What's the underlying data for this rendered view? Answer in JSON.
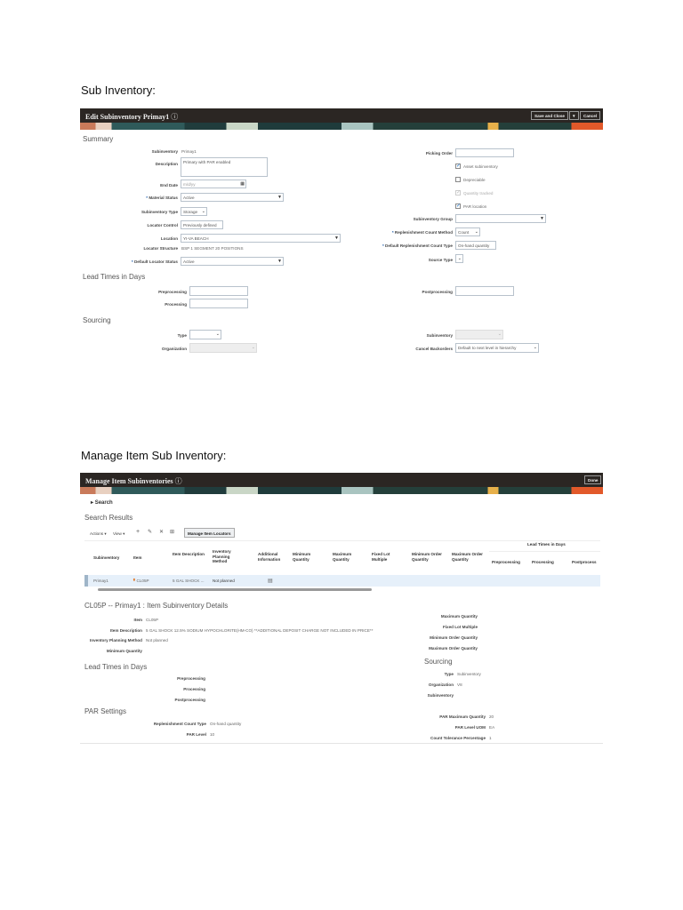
{
  "doc": {
    "heading1": "Sub Inventory:",
    "heading2": "Manage Item Sub Inventory:"
  },
  "edit": {
    "title": "Edit Subinventory Primay1",
    "help_icon": "question-circle-icon",
    "save_close": "Save and Close",
    "save_menu": "▼",
    "cancel": "Cancel",
    "summary": "Summary",
    "subinventory_label": "Subinventory",
    "subinventory": "Primay1",
    "description_label": "Description",
    "description": "Primary with PAR enabled",
    "end_date_label": "End Date",
    "end_date_placeholder": "m/d/yy",
    "material_status_label": "Material Status",
    "material_status": "Active",
    "sub_type_label": "Subinventory Type",
    "sub_type": "Storage",
    "locator_control_label": "Locator Control",
    "locator_control": "Previously defined",
    "location_label": "Location",
    "location": "YI-VA BEACH",
    "locator_structure_label": "Locator Structure",
    "locator_structure": "BSP 1 SEGMENT 20 POSITIONS",
    "default_locator_status_label": "Default Locator Status",
    "default_locator_status": "Active",
    "picking_order_label": "Picking Order",
    "asset": "Asset subinventory",
    "asset_checked": true,
    "depreciable": "Depreciable",
    "depreciable_checked": false,
    "qty_tracked": "Quantity tracked",
    "qty_tracked_checked": true,
    "par_location": "PAR location",
    "par_checked": true,
    "sub_group_label": "Subinventory Group",
    "repl_method_label": "Replenishment Count Method",
    "repl_method": "Count",
    "repl_type_label": "Default Replenishment Count Type",
    "repl_type": "On-hand quantity",
    "source_type_label": "Source Type",
    "lead_times": "Lead Times in Days",
    "preprocessing": "Preprocessing",
    "processing": "Processing",
    "postprocessing": "Postprocessing",
    "sourcing": "Sourcing",
    "type_label": "Type",
    "organization_label": "Organization",
    "src_sub_label": "Subinventory",
    "cancel_backorders_label": "Cancel Backorders",
    "cancel_backorders": "Default to next level in hierarchy"
  },
  "manage": {
    "title": "Manage Item Subinventories",
    "done": "Done",
    "search": "Search",
    "results": "Search Results",
    "actions": "Actions ▾",
    "view": "View ▾",
    "manage_locators": "Manage Item Locators",
    "columns": [
      "Subinventory",
      "Item",
      "Item Description",
      "Inventory Planning Method",
      "Additional Information",
      "Minimum Quantity",
      "Maximum Quantity",
      "Fixed Lot Multiple",
      "Minimum Order Quantity",
      "Maximum Order Quantity",
      "Preprocessing",
      "Processing",
      "Postprocess"
    ],
    "group_header": "Lead Times in Days",
    "row": {
      "subinventory": "Primay1",
      "item": "CL05P",
      "description": "5 GAL SHOCK ...",
      "planning": "Not planned"
    },
    "details_title": "CL05P -- Primay1 : Item Subinventory Details",
    "d": {
      "item_label": "Item",
      "item": "CL05P",
      "desc_label": "Item Description",
      "desc": "5 GAL SHOCK 12.5% SODIUM HYPOCHLORITE(HM-CO) **ADDITIONAL DEPOSIT CHARGE NOT INCLUDED IN PRICE**",
      "ipm_label": "Inventory Planning Method",
      "ipm": "Not planned",
      "minq_label": "Minimum Quantity",
      "lead_times": "Lead Times in Days",
      "pre": "Preprocessing",
      "proc": "Processing",
      "post": "Postprocessing",
      "par": "PAR Settings",
      "rct_label": "Replenishment Count Type",
      "rct": "On-hand quantity",
      "parl_label": "PAR Level",
      "parl": "10",
      "maxq_label": "Maximum Quantity",
      "flm_label": "Fixed Lot Multiple",
      "minoq_label": "Minimum Order Quantity",
      "maxoq_label": "Maximum Order Quantity",
      "sourcing": "Sourcing",
      "type_label": "Type",
      "type": "Subinventory",
      "org_label": "Organization",
      "org": "V8",
      "sub_label": "Subinventory",
      "parmax_label": "PAR Maximum Quantity",
      "parmax": "20",
      "uom_label": "PAR Level UOM",
      "uom": "EA",
      "ctp_label": "Count Tolerance Percentage",
      "ctp": "1"
    }
  }
}
